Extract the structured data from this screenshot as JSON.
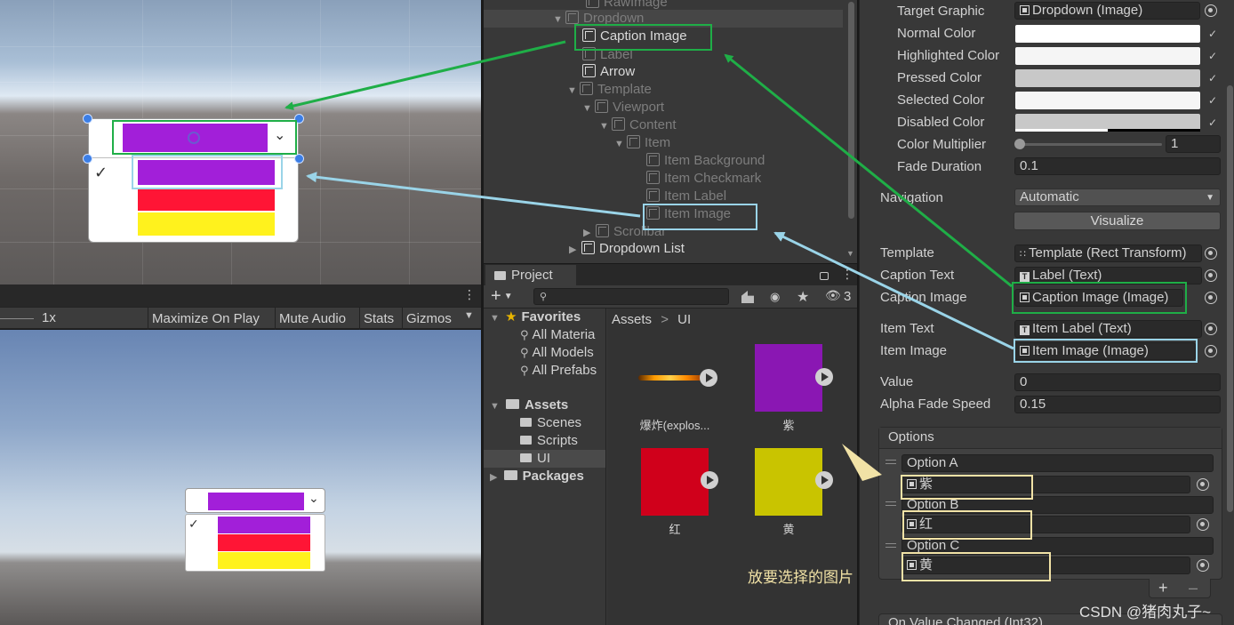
{
  "scene": {
    "grid": true
  },
  "game_toolbar": {
    "scale_label": "1x",
    "maximize_label": "Maximize On Play",
    "mute_label": "Mute Audio",
    "stats_label": "Stats",
    "gizmos_label": "Gizmos"
  },
  "hierarchy": {
    "items": [
      {
        "label": "RawImage"
      },
      {
        "label": "Dropdown"
      },
      {
        "label": "Caption Image"
      },
      {
        "label": "Label"
      },
      {
        "label": "Arrow"
      },
      {
        "label": "Template"
      },
      {
        "label": "Viewport"
      },
      {
        "label": "Content"
      },
      {
        "label": "Item"
      },
      {
        "label": "Item Background"
      },
      {
        "label": "Item Checkmark"
      },
      {
        "label": "Item Label"
      },
      {
        "label": "Item Image"
      },
      {
        "label": "Scrollbar"
      },
      {
        "label": "Dropdown List"
      }
    ]
  },
  "project": {
    "tab_label": "Project",
    "hidden_count": "3",
    "favorites_label": "Favorites",
    "favorites": [
      "All Materia",
      "All Models",
      "All Prefabs"
    ],
    "assets_label": "Assets",
    "assets_children": [
      "Scenes",
      "Scripts",
      "UI"
    ],
    "packages_label": "Packages",
    "breadcrumb_root": "Assets",
    "breadcrumb_sep": ">",
    "breadcrumb_current": "UI",
    "assets": [
      {
        "name": "爆炸(explos...",
        "color": "#2a2a2a"
      },
      {
        "name": "紫",
        "color": "#8a17b3"
      },
      {
        "name": "红",
        "color": "#d0001b"
      },
      {
        "name": "黄",
        "color": "#c9c400"
      }
    ]
  },
  "inspector": {
    "target_graphic_label": "Target Graphic",
    "target_graphic_value": "Dropdown (Image)",
    "normal_color_label": "Normal Color",
    "highlighted_color_label": "Highlighted Color",
    "pressed_color_label": "Pressed Color",
    "selected_color_label": "Selected Color",
    "disabled_color_label": "Disabled Color",
    "color_multiplier_label": "Color Multiplier",
    "color_multiplier_value": "1",
    "color_multiplier_fraction": 0.0,
    "fade_duration_label": "Fade Duration",
    "fade_duration_value": "0.1",
    "navigation_label": "Navigation",
    "navigation_value": "Automatic",
    "visualize_label": "Visualize",
    "template_label": "Template",
    "template_value": "Template (Rect Transform)",
    "caption_text_label": "Caption Text",
    "caption_text_value": "Label (Text)",
    "caption_image_label": "Caption Image",
    "caption_image_value": "Caption Image (Image)",
    "item_text_label": "Item Text",
    "item_text_value": "Item Label (Text)",
    "item_image_label": "Item Image",
    "item_image_value": "Item Image (Image)",
    "value_label": "Value",
    "value_value": "0",
    "alpha_fade_label": "Alpha Fade Speed",
    "alpha_fade_value": "0.15",
    "options_label": "Options",
    "options": [
      {
        "text": "Option A",
        "image": "紫"
      },
      {
        "text": "Option B",
        "image": "红"
      },
      {
        "text": "Option C",
        "image": "黄"
      }
    ],
    "on_value_changed_label": "On Value Changed (Int32)",
    "colors": {
      "normal": "#ffffff",
      "highlighted": "#f5f5f5",
      "pressed": "#c8c8c8",
      "selected": "#f5f5f5",
      "disabled": "#c8c8c8"
    }
  },
  "annotation": {
    "note": "放要选择的图片",
    "watermark": "CSDN @猪肉丸子~"
  },
  "colors": {
    "purple": "#a21fd9",
    "red": "#ff1535",
    "yellow": "#fff21d",
    "green_box": "#1fae47",
    "blue_box": "#9ad4e8",
    "cream_box": "#f1e2a6"
  }
}
